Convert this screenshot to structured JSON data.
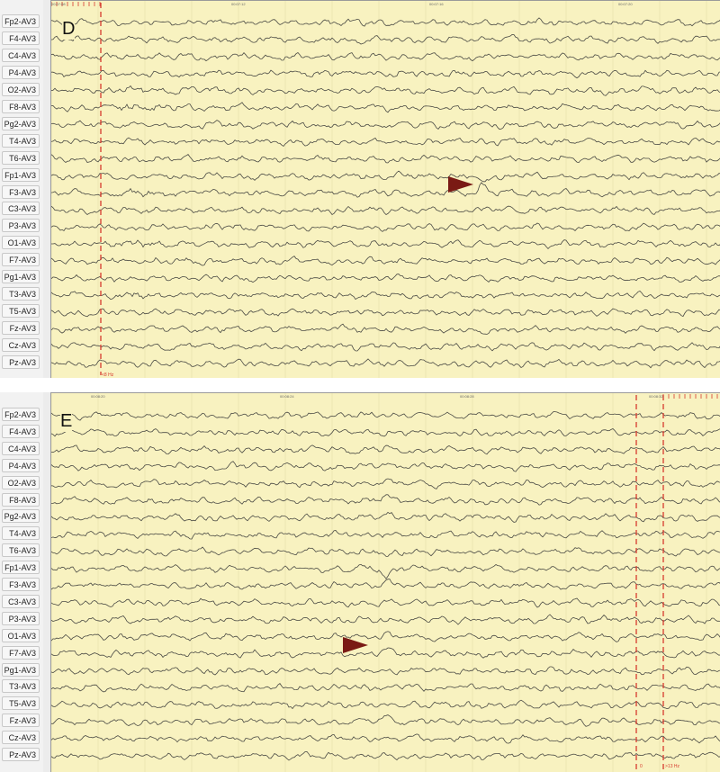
{
  "channels": [
    "Fp2-AV3",
    "F4-AV3",
    "C4-AV3",
    "P4-AV3",
    "O2-AV3",
    "F8-AV3",
    "Pg2-AV3",
    "T4-AV3",
    "T6-AV3",
    "Fp1-AV3",
    "F3-AV3",
    "C3-AV3",
    "P3-AV3",
    "O1-AV3",
    "F7-AV3",
    "Pg1-AV3",
    "T3-AV3",
    "T5-AV3",
    "Fz-AV3",
    "Cz-AV3",
    "Pz-AV3"
  ],
  "panels": [
    {
      "letter": "D",
      "time_ticks": [
        "00:07:08",
        "00:07:12",
        "00:07:16",
        "00:07:20"
      ],
      "markers": [
        {
          "label": "<8 Hz"
        }
      ]
    },
    {
      "letter": "E",
      "time_ticks": [
        "00:08:20",
        "00:08:24",
        "00:08:28",
        "00:08:32"
      ],
      "markers": [
        {
          "label": "0"
        },
        {
          "label": ">13 Hz"
        }
      ]
    }
  ],
  "colors": {
    "trace": "#4a4a44",
    "background": "#f8f2c0",
    "marker": "#d63a2e",
    "arrow": "#7a1a14"
  }
}
